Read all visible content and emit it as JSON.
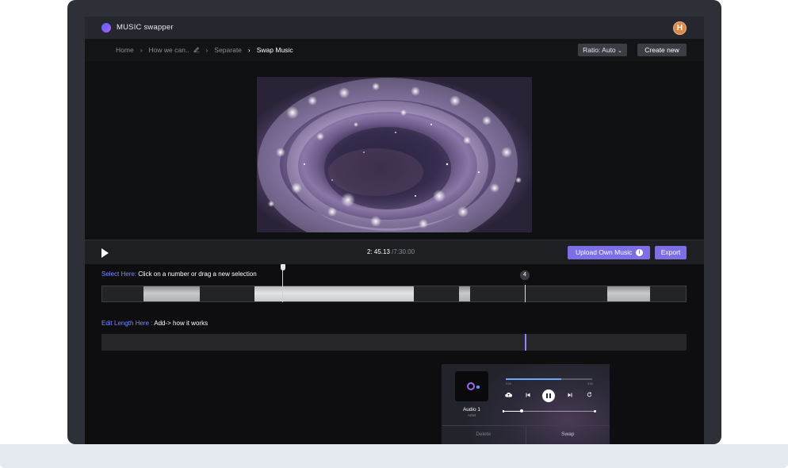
{
  "header": {
    "app_title": "MUSIC swapper",
    "avatar_initial": "H"
  },
  "breadcrumb": {
    "home": "Home",
    "project": "How we can..",
    "separate": "Separate",
    "current": "Swap Music",
    "separator": "›"
  },
  "toolbar": {
    "ratio_label": "Ratio: Auto",
    "ratio_chevron": "⌄",
    "create_label": "Create new"
  },
  "controls": {
    "current_time": "2: 45.13",
    "total_time": " /7:30.00",
    "upload_label": "Upload Own Music",
    "info_glyph": "i",
    "export_label": "Export"
  },
  "selection": {
    "hint": "Select Here:",
    "text": " Click on a number or drag a new selection",
    "marker_number": "4"
  },
  "edit": {
    "hint": "Edit Length Here :",
    "text": " Add-> how it works"
  },
  "player": {
    "title": "Audio 1",
    "artist": "Artist",
    "time_start": "0:00",
    "time_end": "3:40",
    "progress": 0.64,
    "volume": 0.2,
    "delete_label": "Delete",
    "swap_label": "Swap"
  },
  "colors": {
    "accent": "#7c6fe6",
    "link": "#7c8cff",
    "avatar": "#d98a4d",
    "progress": "#6da7ff"
  },
  "icons": [
    "logo-icon",
    "pencil-icon",
    "play-icon",
    "info-icon",
    "cloud-upload-icon",
    "previous-icon",
    "pause-icon",
    "next-icon",
    "repeat-icon"
  ]
}
